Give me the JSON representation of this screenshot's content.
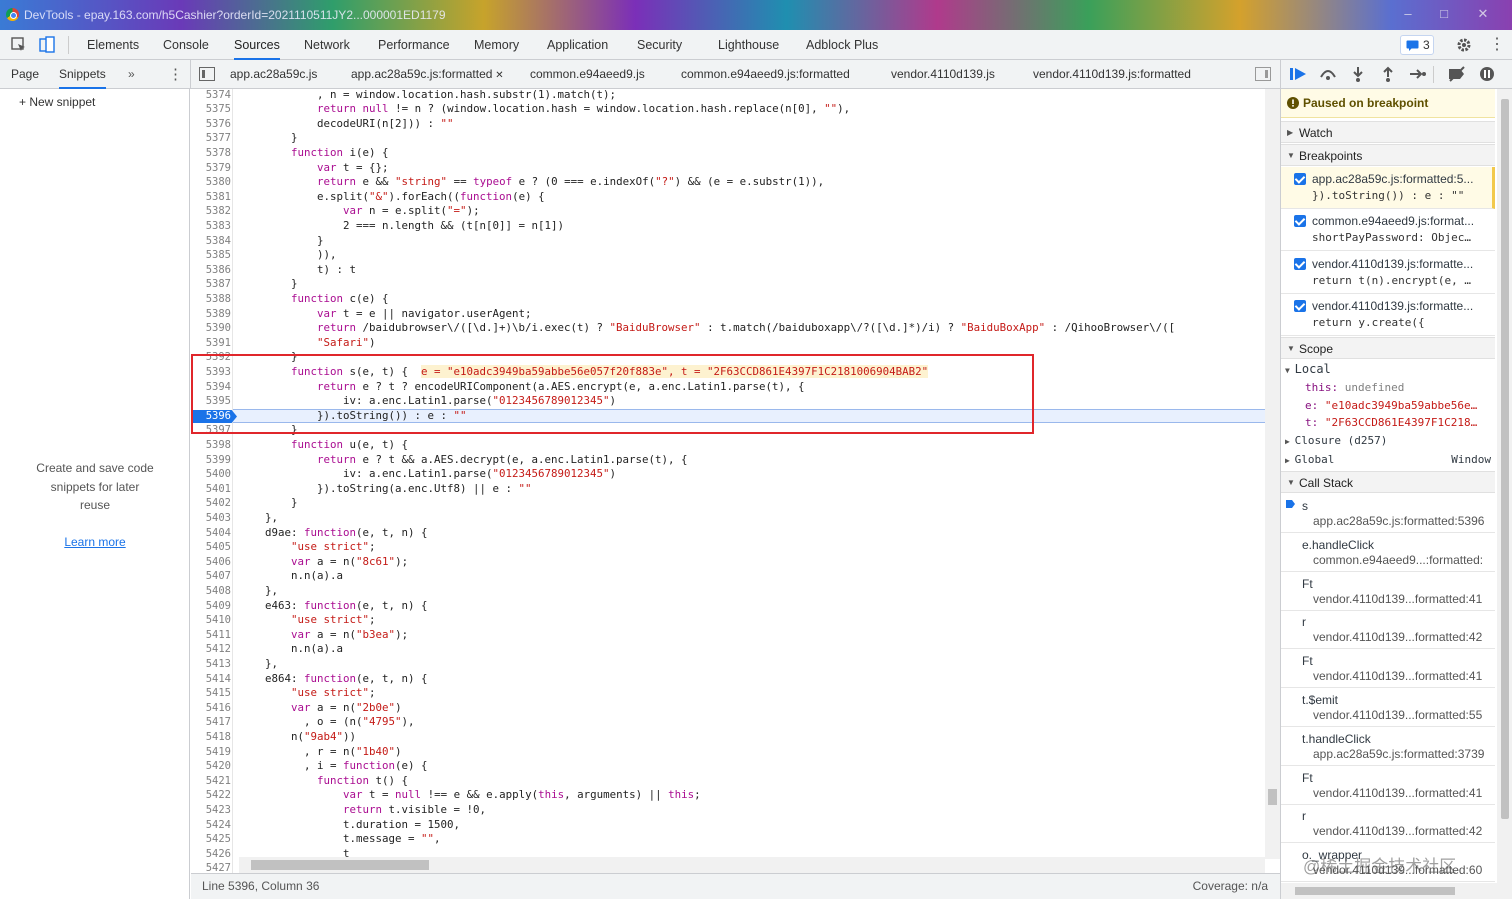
{
  "window": {
    "title": "DevTools - epay.163.com/h5Cashier?orderId=2021110511JY2...000001ED1179"
  },
  "toolbar": {
    "tabs": [
      "Elements",
      "Console",
      "Sources",
      "Network",
      "Performance",
      "Memory",
      "Application",
      "Security",
      "Lighthouse",
      "Adblock Plus"
    ],
    "active": "Sources",
    "message_count": "3"
  },
  "navigator": {
    "tabs": [
      "Page",
      "Snippets"
    ],
    "active": "Snippets",
    "more": "»",
    "new_snippet": "+ New snippet",
    "empty_text": [
      "Create and save code",
      "snippets for later",
      "reuse"
    ],
    "learn_more": "Learn more"
  },
  "file_tabs": [
    {
      "label": "app.ac28a59c.js",
      "closable": false
    },
    {
      "label": "app.ac28a59c.js:formatted",
      "closable": true,
      "active": true
    },
    {
      "label": "common.e94aeed9.js",
      "closable": false
    },
    {
      "label": "common.e94aeed9.js:formatted",
      "closable": false
    },
    {
      "label": "vendor.4110d139.js",
      "closable": false
    },
    {
      "label": "vendor.4110d139.js:formatted",
      "closable": false
    }
  ],
  "editor": {
    "current_line": "5396",
    "lines": [
      {
        "n": "5374",
        "t": "            , n = window.location.hash.substr(1).match(t);"
      },
      {
        "n": "5375",
        "t": "            return null != n ? (window.location.hash = window.location.hash.replace(n[0], \"\"),"
      },
      {
        "n": "5376",
        "t": "            decodeURI(n[2])) : \"\""
      },
      {
        "n": "5377",
        "t": "        }"
      },
      {
        "n": "5378",
        "t": "        function i(e) {"
      },
      {
        "n": "5379",
        "t": "            var t = {};"
      },
      {
        "n": "5380",
        "t": "            return e && \"string\" == typeof e ? (0 === e.indexOf(\"?\") && (e = e.substr(1)),"
      },
      {
        "n": "5381",
        "t": "            e.split(\"&\").forEach((function(e) {"
      },
      {
        "n": "5382",
        "t": "                var n = e.split(\"=\");"
      },
      {
        "n": "5383",
        "t": "                2 === n.length && (t[n[0]] = n[1])"
      },
      {
        "n": "5384",
        "t": "            }"
      },
      {
        "n": "5385",
        "t": "            )),"
      },
      {
        "n": "5386",
        "t": "            t) : t"
      },
      {
        "n": "5387",
        "t": "        }"
      },
      {
        "n": "5388",
        "t": "        function c(e) {"
      },
      {
        "n": "5389",
        "t": "            var t = e || navigator.userAgent;"
      },
      {
        "n": "5390",
        "t": "            return /baidubrowser\\/([\\d.]+)\\b/i.exec(t) ? \"BaiduBrowser\" : t.match(/baiduboxapp\\/?([\\d.]*)/i) ? \"BaiduBoxApp\" : /QihooBrowser\\/(["
      },
      {
        "n": "5391",
        "t": "            \"Safari\")"
      },
      {
        "n": "5392",
        "t": "        }"
      },
      {
        "n": "5393",
        "t": "        function s(e, t) {  "
      },
      {
        "n": "5394",
        "t": "            return e ? t ? encodeURIComponent(a.AES.encrypt(e, a.enc.Latin1.parse(t), {"
      },
      {
        "n": "5395",
        "t": "                iv: a.enc.Latin1.parse(\"0123456789012345\")"
      },
      {
        "n": "5396",
        "t": "            }).toString()) : e : \"\""
      },
      {
        "n": "5397",
        "t": "        }"
      },
      {
        "n": "5398",
        "t": "        function u(e, t) {"
      },
      {
        "n": "5399",
        "t": "            return e ? t && a.AES.decrypt(e, a.enc.Latin1.parse(t), {"
      },
      {
        "n": "5400",
        "t": "                iv: a.enc.Latin1.parse(\"0123456789012345\")"
      },
      {
        "n": "5401",
        "t": "            }).toString(a.enc.Utf8) || e : \"\""
      },
      {
        "n": "5402",
        "t": "        }"
      },
      {
        "n": "5403",
        "t": "    },"
      },
      {
        "n": "5404",
        "t": "    d9ae: function(e, t, n) {"
      },
      {
        "n": "5405",
        "t": "        \"use strict\";"
      },
      {
        "n": "5406",
        "t": "        var a = n(\"8c61\");"
      },
      {
        "n": "5407",
        "t": "        n.n(a).a"
      },
      {
        "n": "5408",
        "t": "    },"
      },
      {
        "n": "5409",
        "t": "    e463: function(e, t, n) {"
      },
      {
        "n": "5410",
        "t": "        \"use strict\";"
      },
      {
        "n": "5411",
        "t": "        var a = n(\"b3ea\");"
      },
      {
        "n": "5412",
        "t": "        n.n(a).a"
      },
      {
        "n": "5413",
        "t": "    },"
      },
      {
        "n": "5414",
        "t": "    e864: function(e, t, n) {"
      },
      {
        "n": "5415",
        "t": "        \"use strict\";"
      },
      {
        "n": "5416",
        "t": "        var a = n(\"2b0e\")"
      },
      {
        "n": "5417",
        "t": "          , o = (n(\"4795\"),"
      },
      {
        "n": "5418",
        "t": "        n(\"9ab4\"))"
      },
      {
        "n": "5419",
        "t": "          , r = n(\"1b40\")"
      },
      {
        "n": "5420",
        "t": "          , i = function(e) {"
      },
      {
        "n": "5421",
        "t": "            function t() {"
      },
      {
        "n": "5422",
        "t": "                var t = null !== e && e.apply(this, arguments) || this;"
      },
      {
        "n": "5423",
        "t": "                return t.visible = !0,"
      },
      {
        "n": "5424",
        "t": "                t.duration = 1500,"
      },
      {
        "n": "5425",
        "t": "                t.message = \"\","
      },
      {
        "n": "5426",
        "t": "                t"
      },
      {
        "n": "5427",
        "t": ""
      }
    ],
    "inline_values": "e = \"e10adc3949ba59abbe56e057f20f883e\", t = \"2F63CCD861E4397F1C2181006904BAB2\""
  },
  "status": {
    "position": "Line 5396, Column 36",
    "coverage": "Coverage: n/a"
  },
  "debugger": {
    "paused": "Paused on breakpoint",
    "sections": {
      "watch": "Watch",
      "breakpoints": "Breakpoints",
      "scope": "Scope",
      "call_stack": "Call Stack"
    },
    "breakpoints": [
      {
        "file": "app.ac28a59c.js:formatted:5...",
        "code": "}).toString()) : e : \"\""
      },
      {
        "file": "common.e94aeed9.js:format...",
        "code": "shortPayPassword: Objec…"
      },
      {
        "file": "vendor.4110d139.js:formatte...",
        "code": "return t(n).encrypt(e, …"
      },
      {
        "file": "vendor.4110d139.js:formatte...",
        "code": "return y.create({"
      }
    ],
    "scope": {
      "local": "Local",
      "vars": [
        {
          "name": "this:",
          "value": "undefined"
        },
        {
          "name": "e:",
          "value": "\"e10adc3949ba59abbe56e…"
        },
        {
          "name": "t:",
          "value": "\"2F63CCD861E4397F1C218…"
        }
      ],
      "closure": "Closure (d257)",
      "global": "Global",
      "global_value": "Window"
    },
    "call_stack": [
      {
        "fn": "s",
        "loc": "app.ac28a59c.js:formatted:5396"
      },
      {
        "fn": "e.handleClick",
        "loc": "common.e94aeed9...:formatted:"
      },
      {
        "fn": "Ft",
        "loc": "vendor.4110d139...formatted:41"
      },
      {
        "fn": "r",
        "loc": "vendor.4110d139...formatted:42"
      },
      {
        "fn": "Ft",
        "loc": "vendor.4110d139...formatted:41"
      },
      {
        "fn": "t.$emit",
        "loc": "vendor.4110d139...formatted:55"
      },
      {
        "fn": "t.handleClick",
        "loc": "app.ac28a59c.js:formatted:3739"
      },
      {
        "fn": "Ft",
        "loc": "vendor.4110d139...formatted:41"
      },
      {
        "fn": "r",
        "loc": "vendor.4110d139...formatted:42"
      },
      {
        "fn": "o._wrapper",
        "loc": "vendor.4110d139...formatted:60"
      }
    ]
  },
  "watermark": "@稀土掘金技术社区",
  "colors": {
    "accent": "#1a73e8",
    "highlight_box": "#e0262b",
    "pause_bg": "#fffbe6",
    "current_line": "#e8f0fe"
  }
}
